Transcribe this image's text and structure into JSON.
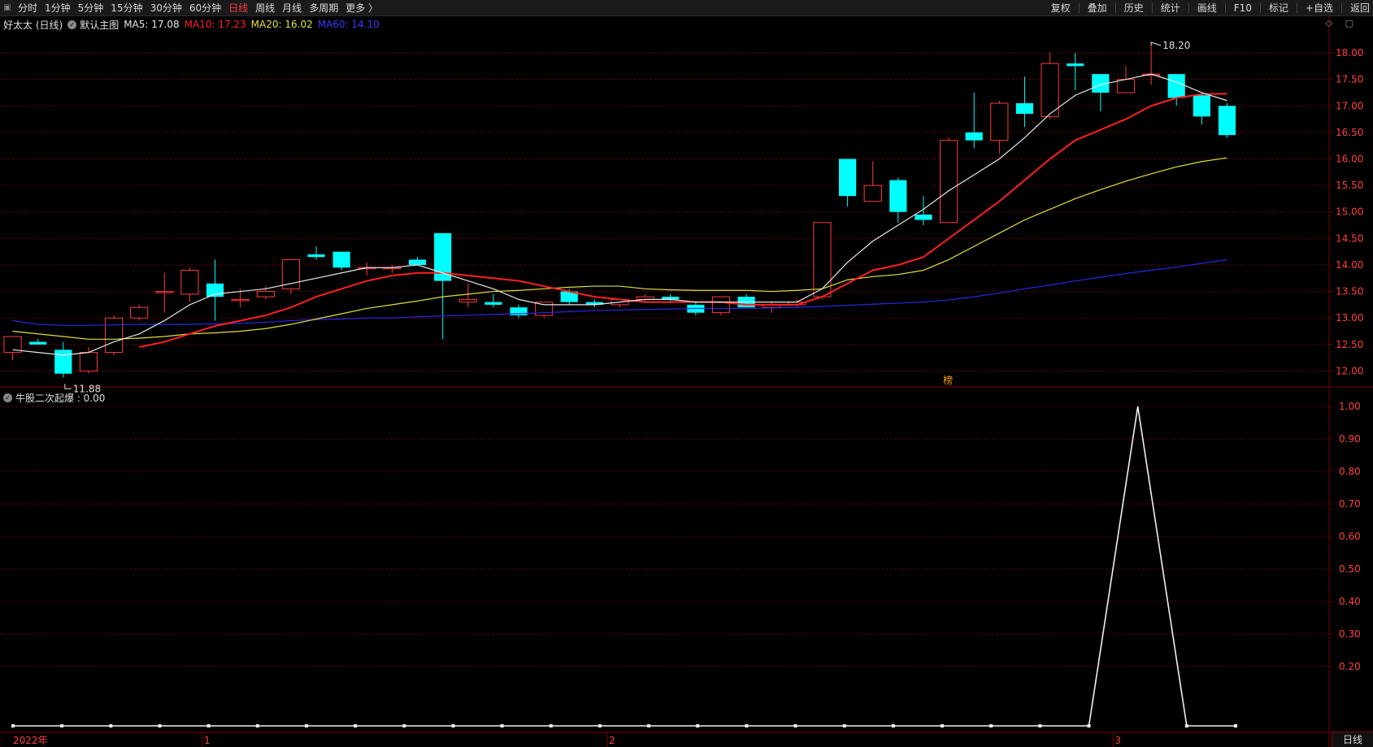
{
  "toolbar": {
    "left_items": [
      "分时",
      "1分钟",
      "5分钟",
      "15分钟",
      "30分钟",
      "60分钟",
      "日线",
      "周线",
      "月线",
      "多周期",
      "更多 〉"
    ],
    "active_item": "日线",
    "right_items": [
      "复权",
      "叠加",
      "历史",
      "统计",
      "画线",
      "F10",
      "标记",
      "+自选",
      "返回"
    ]
  },
  "main_legend": {
    "stock": "好太太 (日线)",
    "template": "默认主图",
    "ma5": "MA5: 17.08",
    "ma10": "MA10: 17.23",
    "ma20": "MA20: 16.02",
    "ma60": "MA60: 14.10"
  },
  "indicator_legend": {
    "label": "牛股二次起爆 : 0.00"
  },
  "annotations": {
    "low_label": "11.88",
    "high_label": "18.20",
    "bang_label": "榜"
  },
  "corner_label": "日线",
  "colors": {
    "up": "#ff3b3b",
    "down": "#00ffff",
    "ma5": "#e8e8e8",
    "ma10": "#ff2020",
    "ma20": "#e0e040",
    "ma60": "#2828e8",
    "grid": "#7a0000",
    "axis_text": "#ff4040"
  },
  "chart_data": [
    {
      "type": "candlestick",
      "title": "好太太 (日线)",
      "ylim": [
        11.7,
        18.2
      ],
      "y_ticks": [
        12.0,
        12.5,
        13.0,
        13.5,
        14.0,
        14.5,
        15.0,
        15.5,
        16.0,
        16.5,
        17.0,
        17.5,
        18.0
      ],
      "x_labels": [
        {
          "index": 0,
          "label": "2022年"
        },
        {
          "index": 8,
          "label": "1"
        },
        {
          "index": 24,
          "label": "2"
        },
        {
          "index": 44,
          "label": "3"
        }
      ],
      "candles": [
        {
          "o": 12.35,
          "h": 12.55,
          "l": 12.2,
          "c": 12.65
        },
        {
          "o": 12.55,
          "h": 12.6,
          "l": 12.5,
          "c": 12.5
        },
        {
          "o": 12.4,
          "h": 12.55,
          "l": 11.88,
          "c": 11.95
        },
        {
          "o": 12.0,
          "h": 12.45,
          "l": 11.95,
          "c": 12.35
        },
        {
          "o": 12.35,
          "h": 13.05,
          "l": 12.3,
          "c": 13.0
        },
        {
          "o": 13.0,
          "h": 13.25,
          "l": 12.95,
          "c": 13.2
        },
        {
          "o": 13.5,
          "h": 13.85,
          "l": 13.1,
          "c": 13.5
        },
        {
          "o": 13.45,
          "h": 13.95,
          "l": 13.3,
          "c": 13.9
        },
        {
          "o": 13.65,
          "h": 14.1,
          "l": 12.95,
          "c": 13.4
        },
        {
          "o": 13.35,
          "h": 13.55,
          "l": 13.2,
          "c": 13.35
        },
        {
          "o": 13.4,
          "h": 13.6,
          "l": 13.35,
          "c": 13.5
        },
        {
          "o": 13.55,
          "h": 14.1,
          "l": 13.45,
          "c": 14.1
        },
        {
          "o": 14.2,
          "h": 14.35,
          "l": 14.1,
          "c": 14.15
        },
        {
          "o": 14.25,
          "h": 14.25,
          "l": 13.9,
          "c": 13.95
        },
        {
          "o": 13.95,
          "h": 14.05,
          "l": 13.8,
          "c": 13.95
        },
        {
          "o": 13.95,
          "h": 14.0,
          "l": 13.85,
          "c": 13.95
        },
        {
          "o": 14.1,
          "h": 14.15,
          "l": 14.0,
          "c": 14.0
        },
        {
          "o": 14.6,
          "h": 14.6,
          "l": 12.6,
          "c": 13.7
        },
        {
          "o": 13.3,
          "h": 13.65,
          "l": 13.2,
          "c": 13.35
        },
        {
          "o": 13.3,
          "h": 13.45,
          "l": 13.2,
          "c": 13.25
        },
        {
          "o": 13.2,
          "h": 13.25,
          "l": 13.0,
          "c": 13.05
        },
        {
          "o": 13.05,
          "h": 13.3,
          "l": 13.0,
          "c": 13.3
        },
        {
          "o": 13.5,
          "h": 13.55,
          "l": 13.25,
          "c": 13.3
        },
        {
          "o": 13.3,
          "h": 13.35,
          "l": 13.2,
          "c": 13.25
        },
        {
          "o": 13.25,
          "h": 13.35,
          "l": 13.2,
          "c": 13.35
        },
        {
          "o": 13.35,
          "h": 13.45,
          "l": 13.3,
          "c": 13.4
        },
        {
          "o": 13.4,
          "h": 13.45,
          "l": 13.3,
          "c": 13.35
        },
        {
          "o": 13.25,
          "h": 13.3,
          "l": 13.05,
          "c": 13.1
        },
        {
          "o": 13.1,
          "h": 13.4,
          "l": 13.05,
          "c": 13.4
        },
        {
          "o": 13.4,
          "h": 13.45,
          "l": 13.2,
          "c": 13.2
        },
        {
          "o": 13.2,
          "h": 13.3,
          "l": 13.1,
          "c": 13.25
        },
        {
          "o": 13.25,
          "h": 13.35,
          "l": 13.2,
          "c": 13.3
        },
        {
          "o": 13.4,
          "h": 14.8,
          "l": 13.35,
          "c": 14.8
        },
        {
          "o": 16.0,
          "h": 16.0,
          "l": 15.1,
          "c": 15.3
        },
        {
          "o": 15.2,
          "h": 15.95,
          "l": 15.2,
          "c": 15.5
        },
        {
          "o": 15.6,
          "h": 15.65,
          "l": 14.8,
          "c": 15.0
        },
        {
          "o": 14.95,
          "h": 15.3,
          "l": 14.75,
          "c": 14.85
        },
        {
          "o": 14.8,
          "h": 16.4,
          "l": 14.8,
          "c": 16.35
        },
        {
          "o": 16.5,
          "h": 17.25,
          "l": 16.2,
          "c": 16.35
        },
        {
          "o": 16.35,
          "h": 17.1,
          "l": 16.1,
          "c": 17.05
        },
        {
          "o": 17.05,
          "h": 17.55,
          "l": 16.6,
          "c": 16.85
        },
        {
          "o": 16.8,
          "h": 18.0,
          "l": 16.75,
          "c": 17.8
        },
        {
          "o": 17.8,
          "h": 18.0,
          "l": 17.3,
          "c": 17.75
        },
        {
          "o": 17.6,
          "h": 17.6,
          "l": 16.9,
          "c": 17.25
        },
        {
          "o": 17.25,
          "h": 17.75,
          "l": 17.25,
          "c": 17.5
        },
        {
          "o": 17.6,
          "h": 18.2,
          "l": 17.4,
          "c": 17.6
        },
        {
          "o": 17.6,
          "h": 17.6,
          "l": 17.0,
          "c": 17.15
        },
        {
          "o": 17.2,
          "h": 17.25,
          "l": 16.65,
          "c": 16.8
        },
        {
          "o": 17.0,
          "h": 17.05,
          "l": 16.4,
          "c": 16.45
        }
      ],
      "ma5": [
        12.4,
        12.35,
        12.3,
        12.35,
        12.55,
        12.7,
        12.95,
        13.25,
        13.45,
        13.5,
        13.55,
        13.65,
        13.75,
        13.85,
        13.95,
        13.95,
        14.0,
        13.85,
        13.7,
        13.55,
        13.35,
        13.25,
        13.25,
        13.25,
        13.3,
        13.35,
        13.35,
        13.3,
        13.3,
        13.3,
        13.3,
        13.3,
        13.55,
        14.05,
        14.45,
        14.75,
        15.05,
        15.4,
        15.7,
        16.0,
        16.4,
        16.85,
        17.2,
        17.4,
        17.5,
        17.6,
        17.45,
        17.25,
        17.1
      ],
      "ma10": [
        null,
        null,
        null,
        null,
        null,
        12.45,
        12.55,
        12.7,
        12.85,
        12.95,
        13.05,
        13.2,
        13.4,
        13.55,
        13.7,
        13.8,
        13.85,
        13.85,
        13.8,
        13.75,
        13.7,
        13.6,
        13.5,
        13.4,
        13.35,
        13.3,
        13.3,
        13.3,
        13.3,
        13.25,
        13.25,
        13.25,
        13.4,
        13.65,
        13.9,
        14.0,
        14.15,
        14.5,
        14.85,
        15.2,
        15.6,
        16.0,
        16.35,
        16.55,
        16.75,
        17.0,
        17.15,
        17.22,
        17.23
      ],
      "ma20": [
        12.75,
        12.7,
        12.65,
        12.6,
        12.6,
        12.62,
        12.65,
        12.7,
        12.72,
        12.75,
        12.8,
        12.88,
        12.98,
        13.08,
        13.18,
        13.25,
        13.32,
        13.4,
        13.45,
        13.5,
        13.52,
        13.55,
        13.58,
        13.6,
        13.6,
        13.55,
        13.53,
        13.52,
        13.52,
        13.52,
        13.5,
        13.52,
        13.55,
        13.72,
        13.78,
        13.82,
        13.9,
        14.1,
        14.35,
        14.6,
        14.85,
        15.05,
        15.25,
        15.42,
        15.58,
        15.72,
        15.85,
        15.95,
        16.02
      ],
      "ma60": [
        12.95,
        12.88,
        12.86,
        12.86,
        12.87,
        12.88,
        12.88,
        12.88,
        12.89,
        12.9,
        12.92,
        12.95,
        12.97,
        12.98,
        13.0,
        13.0,
        13.02,
        13.04,
        13.05,
        13.07,
        13.08,
        13.1,
        13.12,
        13.14,
        13.15,
        13.16,
        13.17,
        13.18,
        13.18,
        13.18,
        13.19,
        13.2,
        13.22,
        13.24,
        13.26,
        13.28,
        13.3,
        13.34,
        13.4,
        13.47,
        13.55,
        13.62,
        13.7,
        13.77,
        13.84,
        13.9,
        13.96,
        14.03,
        14.1
      ]
    },
    {
      "type": "line",
      "title": "牛股二次起爆",
      "ylim": [
        0,
        1.0
      ],
      "y_ticks": [
        0.2,
        0.3,
        0.4,
        0.5,
        0.6,
        0.7,
        0.8,
        0.9,
        1.0
      ],
      "values": [
        0,
        0,
        0,
        0,
        0,
        0,
        0,
        0,
        0,
        0,
        0,
        0,
        0,
        0,
        0,
        0,
        0,
        0,
        0,
        0,
        0,
        0,
        0,
        1,
        0,
        0
      ]
    }
  ]
}
